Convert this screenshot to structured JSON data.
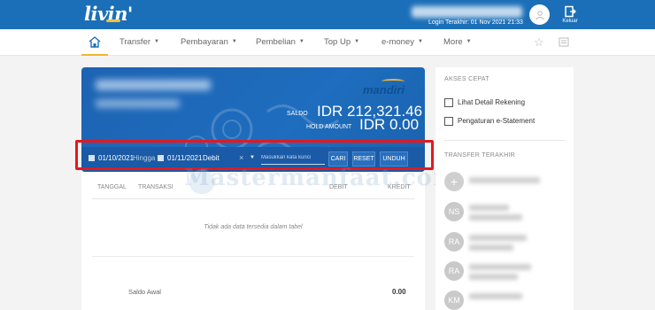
{
  "app": {
    "logo": "livin'"
  },
  "header": {
    "last_login": "Login Terakhir: 01 Nov 2021 21:33",
    "logout_label": "Keluar"
  },
  "nav": {
    "items": [
      {
        "label": "Transfer"
      },
      {
        "label": "Pembayaran"
      },
      {
        "label": "Pembelian"
      },
      {
        "label": "Top Up"
      },
      {
        "label": "e-money"
      },
      {
        "label": "More"
      }
    ]
  },
  "account": {
    "bank_name": "mandiri",
    "saldo_label": "SALDO",
    "saldo_value": "IDR 212,321.46",
    "hold_label": "HOLD AMOUNT",
    "hold_value": "IDR 0.00"
  },
  "filter": {
    "start_date": "01/10/2021",
    "to_label": "Hingga",
    "end_date": "01/11/2021",
    "type_value": "Debit",
    "keyword_placeholder": "Masukkan kata kunci",
    "search_button": "CARI",
    "reset_button": "RESET",
    "download_button": "UNDUH"
  },
  "table": {
    "columns": [
      "TANGGAL",
      "TRANSAKSI",
      "DEBIT",
      "KREDIT"
    ],
    "empty_message": "Tidak ada data tersedia dalam tabel",
    "opening_balance_label": "Saldo Awal",
    "opening_balance_value": "0.00"
  },
  "watermark": "Mastermanfaat.com",
  "sidebar": {
    "quick_access_title": "AKSES CEPAT",
    "quick_links": [
      {
        "label": "Lihat Detail Rekening"
      },
      {
        "label": "Pengaturan e-Statement"
      }
    ],
    "recent_transfer_title": "TRANSFER TERAKHIR",
    "recent_transfers": [
      {
        "initials": "+"
      },
      {
        "initials": "NS"
      },
      {
        "initials": "RA"
      },
      {
        "initials": "RA"
      },
      {
        "initials": "KM"
      }
    ]
  },
  "colors": {
    "brand_blue": "#1b6fb8",
    "accent_yellow": "#f2b531",
    "highlight_red": "#e01a22"
  }
}
